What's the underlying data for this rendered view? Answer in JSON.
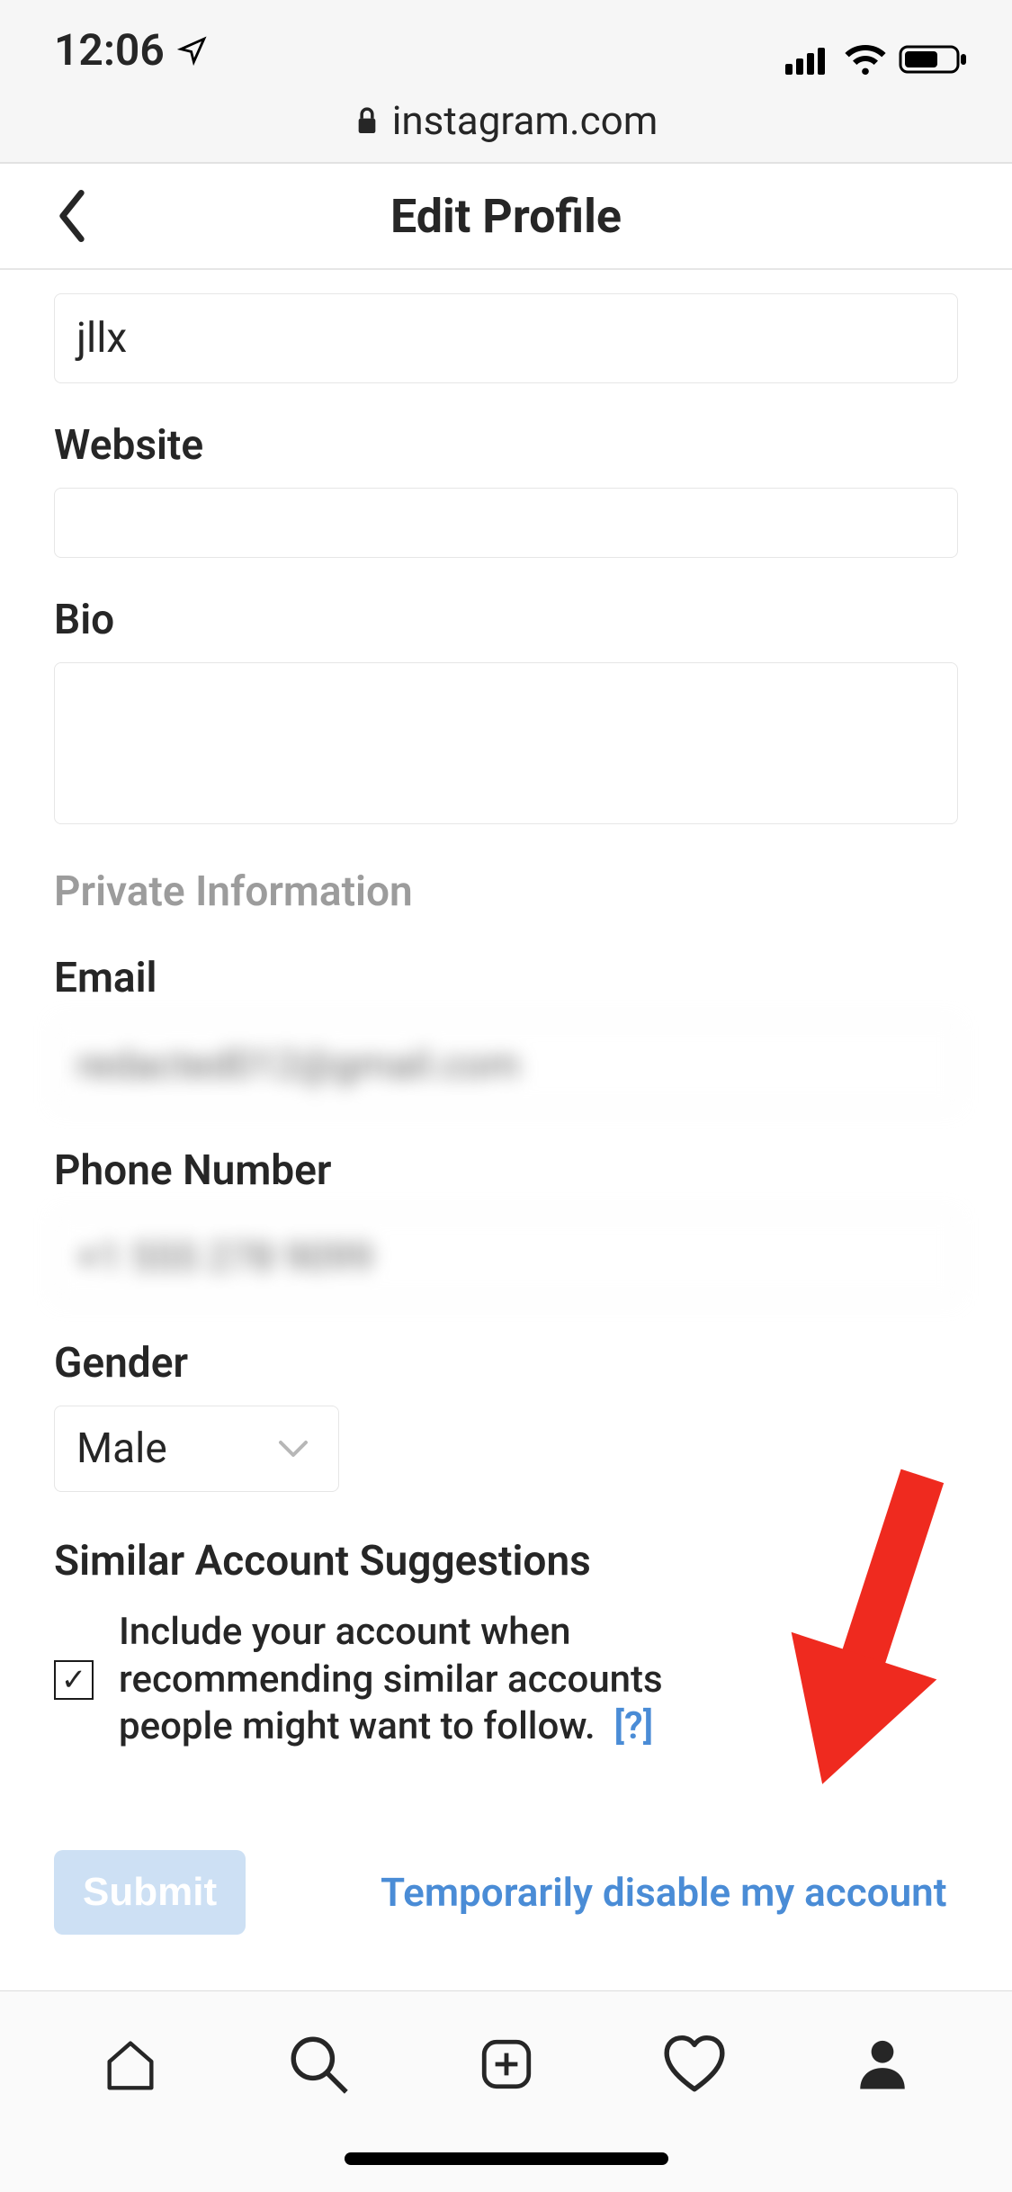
{
  "status": {
    "time": "12:06"
  },
  "browser": {
    "domain": "instagram.com"
  },
  "header": {
    "title": "Edit Profile"
  },
  "form": {
    "username_value": "jllx",
    "website_label": "Website",
    "website_value": "",
    "bio_label": "Bio",
    "bio_value": "",
    "private_section": "Private Information",
    "email_label": "Email",
    "phone_label": "Phone Number",
    "gender_label": "Gender",
    "gender_value": "Male",
    "similar_label": "Similar Account Suggestions",
    "similar_checkbox_text": "Include your account when recommending similar accounts people might want to follow.",
    "help_symbol": "[?]",
    "submit_label": "Submit",
    "disable_link": "Temporarily disable my account"
  }
}
